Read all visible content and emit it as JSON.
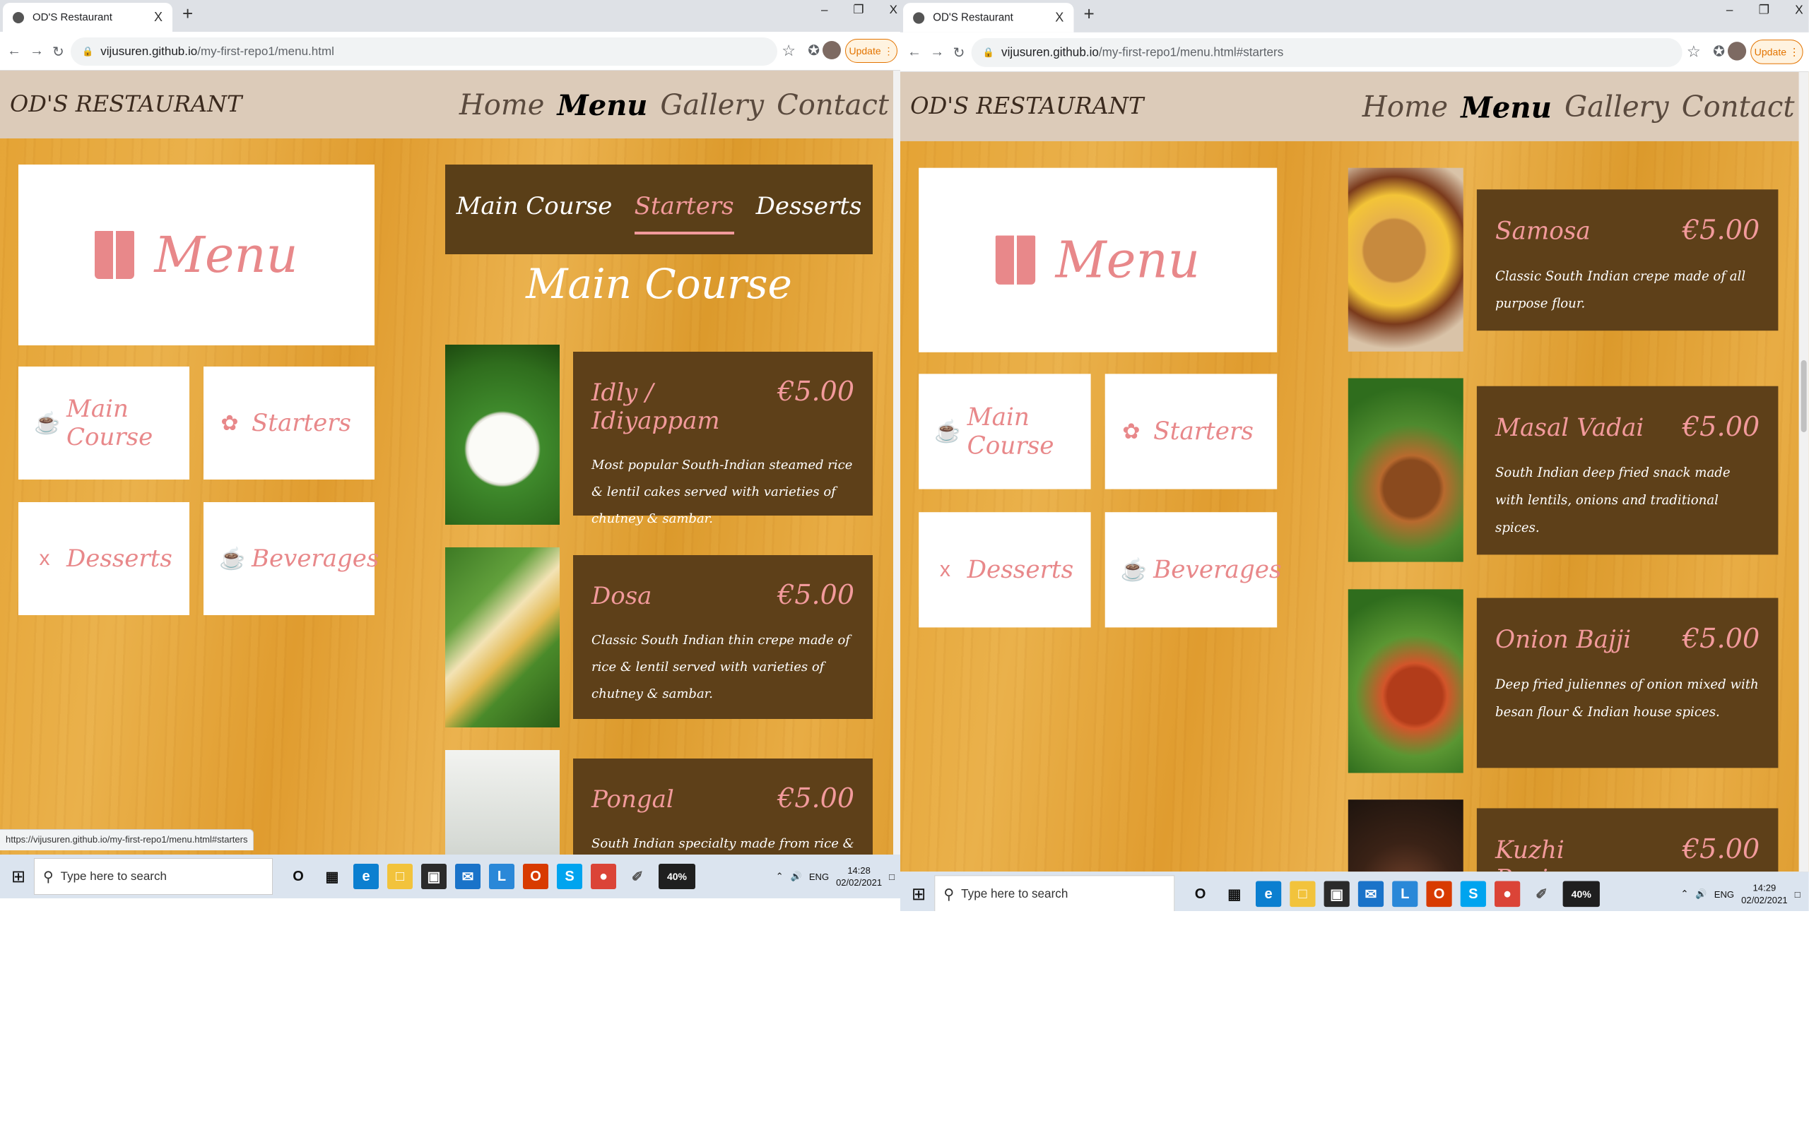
{
  "screens": [
    {
      "tab_title": "OD'S Restaurant",
      "url_domain": "vijusuren.github.io",
      "url_path": "/my-first-repo1/menu.html",
      "status_url": "https://vijusuren.github.io/my-first-repo1/menu.html#starters",
      "clock_time": "14:28",
      "clock_date": "02/02/2021"
    },
    {
      "tab_title": "OD'S Restaurant",
      "url_domain": "vijusuren.github.io",
      "url_path": "/my-first-repo1/menu.html#starters",
      "status_url": "",
      "clock_time": "14:29",
      "clock_date": "02/02/2021"
    }
  ],
  "browser": {
    "update_label": "Update",
    "new_tab_symbol": "+",
    "tab_close_symbol": "X",
    "minimize_symbol": "–",
    "restore_symbol": "❐",
    "close_symbol": "X"
  },
  "site": {
    "brand": "OD'S RESTAURANT",
    "nav": [
      "Home",
      "Menu",
      "Gallery",
      "Contact"
    ],
    "hero_label": "Menu",
    "categories": [
      "Main Course",
      "Starters",
      "Desserts",
      "Beverages"
    ],
    "tabs": [
      "Main Course",
      "Starters",
      "Desserts"
    ],
    "section_title": "Main Course"
  },
  "main_course": [
    {
      "name": "Idly / Idiyappam",
      "price": "€5.00",
      "desc": "Most popular South-Indian steamed rice & lentil cakes served with varieties of chutney & sambar."
    },
    {
      "name": "Dosa",
      "price": "€5.00",
      "desc": "Classic South Indian thin crepe made of rice & lentil served with varieties of chutney & sambar."
    },
    {
      "name": "Pongal",
      "price": "€5.00",
      "desc": "South Indian specialty made from rice & lentil cooked served"
    }
  ],
  "starters": [
    {
      "name": "Samosa",
      "price": "€5.00",
      "desc": "Classic South Indian crepe made of all purpose flour."
    },
    {
      "name": "Masal Vadai",
      "price": "€5.00",
      "desc": "South Indian deep fried snack made with lentils, onions and traditional spices."
    },
    {
      "name": "Onion Bajji",
      "price": "€5.00",
      "desc": "Deep fried juliennes of onion mixed with besan flour & Indian house spices."
    },
    {
      "name": "Kuzhi Paniyaram",
      "price": "€5.00",
      "desc": ""
    }
  ],
  "taskbar": {
    "search_placeholder": "Type here to search",
    "battery": "40%",
    "lang": "ENG"
  },
  "icons": {
    "accent": "#e8888a",
    "card_bg": "#5e4019",
    "header_bg": "#dccbb9"
  }
}
